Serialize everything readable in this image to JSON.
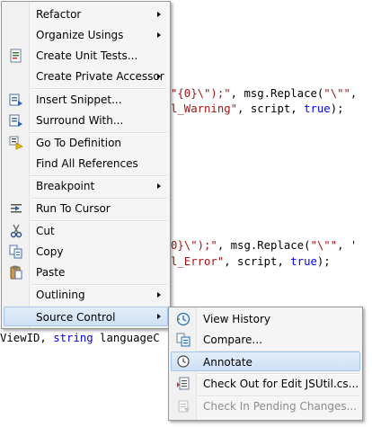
{
  "code": {
    "line1": {
      "s1": "\"{0}\\\");\"",
      "mid": ", msg.Replace(",
      "s2": "\"\\\"\"",
      "tail": ", "
    },
    "line2": {
      "s1": "l_Warning\"",
      "mid": ", script, ",
      "kw": "true",
      "tail": ");"
    },
    "line3": {
      "s1": "0}\\\");\"",
      "mid": ", msg.Replace(",
      "s2": "\"\\\"\"",
      "tail": ", '"
    },
    "line4": {
      "s1": "l_Error\"",
      "mid": ", script, ",
      "kw": "true",
      "tail": ");"
    },
    "line5": {
      "pre": "ViewID, ",
      "kw": "string",
      "post": " languageC"
    }
  },
  "context_menu": {
    "items": [
      {
        "label": "Refactor",
        "submenu": true
      },
      {
        "label": "Organize Usings",
        "submenu": true
      },
      {
        "label": "Create Unit Tests...",
        "icon": "unit-test-icon"
      },
      {
        "label": "Create Private Accessor",
        "submenu": true
      },
      {
        "label": "Insert Snippet...",
        "icon": "insert-snippet-icon"
      },
      {
        "label": "Surround With...",
        "icon": "surround-with-icon"
      },
      {
        "label": "Go To Definition",
        "icon": "go-to-definition-icon"
      },
      {
        "label": "Find All References"
      },
      {
        "label": "Breakpoint",
        "submenu": true
      },
      {
        "label": "Run To Cursor",
        "icon": "run-to-cursor-icon"
      },
      {
        "label": "Cut",
        "icon": "scissors-icon"
      },
      {
        "label": "Copy",
        "icon": "copy-icon"
      },
      {
        "label": "Paste",
        "icon": "paste-icon"
      },
      {
        "label": "Outlining",
        "submenu": true
      },
      {
        "label": "Source Control",
        "submenu": true,
        "state": "open"
      }
    ]
  },
  "submenu": {
    "items": [
      {
        "label": "View History",
        "icon": "view-history-icon"
      },
      {
        "label": "Compare...",
        "icon": "compare-icon"
      },
      {
        "label": "Annotate",
        "icon": "annotate-icon",
        "state": "highlighted"
      },
      {
        "label": "Check Out for Edit JSUtil.cs...",
        "icon": "check-out-icon"
      },
      {
        "label": "Check In Pending Changes...",
        "icon": "check-in-icon",
        "state": "disabled"
      }
    ]
  },
  "colors": {
    "string": "#a31515",
    "keyword": "#0000ff",
    "highlight": "#cfe0f5",
    "menu_bg": "#f5f5f5"
  }
}
